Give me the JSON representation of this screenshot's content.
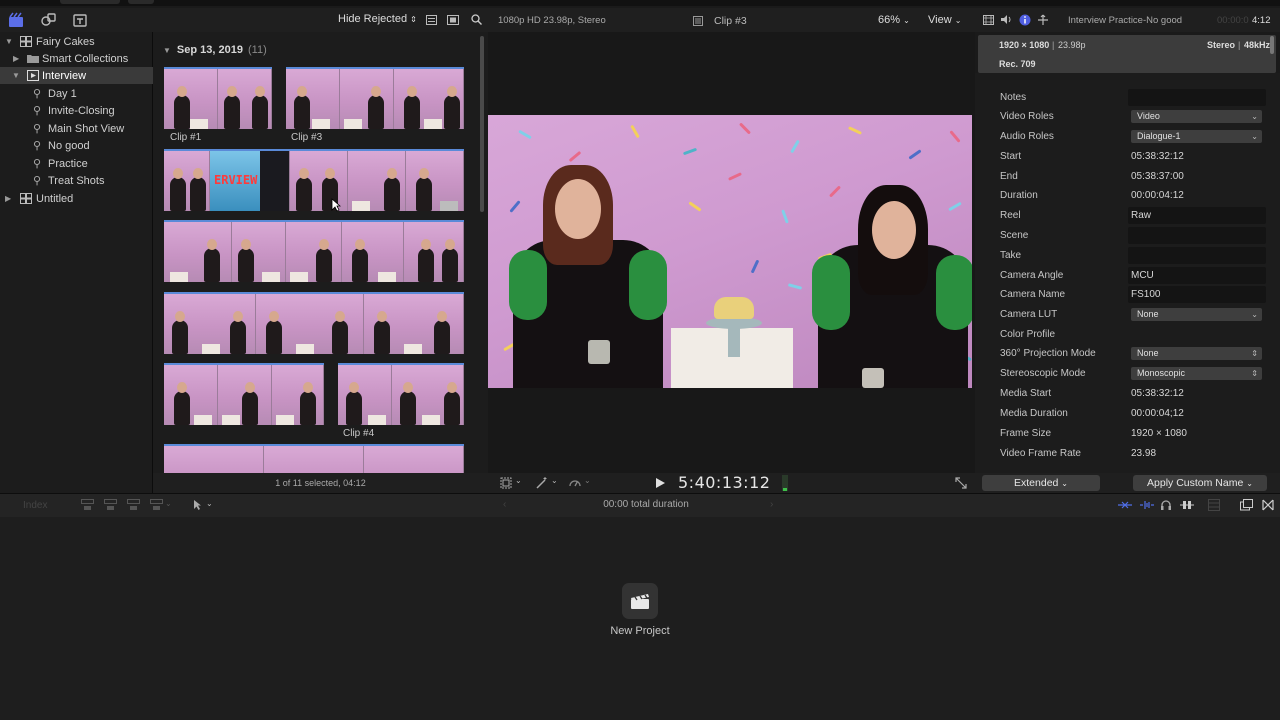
{
  "library": {
    "items": [
      {
        "label": "Fairy Cakes",
        "icon": "library-icon",
        "expanded": true
      },
      {
        "label": "Smart Collections",
        "icon": "folder-icon",
        "expanded": false
      },
      {
        "label": "Interview",
        "icon": "event-icon",
        "expanded": true,
        "selected": true
      },
      {
        "label": "Day 1",
        "icon": "keyword-icon"
      },
      {
        "label": "Invite-Closing",
        "icon": "keyword-icon"
      },
      {
        "label": "Main Shot View",
        "icon": "keyword-icon"
      },
      {
        "label": "No good",
        "icon": "keyword-icon"
      },
      {
        "label": "Practice",
        "icon": "keyword-icon"
      },
      {
        "label": "Treat Shots",
        "icon": "keyword-icon"
      },
      {
        "label": "Untitled",
        "icon": "library-icon",
        "expanded": false
      }
    ]
  },
  "browser": {
    "filter": "Hide Rejected",
    "date_header": "Sep 13, 2019",
    "count": "(11)",
    "clips": [
      "Clip #1",
      "Clip #3",
      "Clip #4"
    ],
    "selection": "1 of 11 selected, 04:12"
  },
  "viewer": {
    "format": "1080p HD 23.98p, Stereo",
    "clip_name": "Clip #3",
    "zoom": "66%",
    "view": "View",
    "timecode": "5:40:13:12"
  },
  "inspector": {
    "title": "Interview Practice-No good",
    "duration_short": "4:12",
    "resolution": "1920 × 1080",
    "framerate": "23.98p",
    "audio": "Stereo",
    "sample_rate": "48kHz",
    "color_space": "Rec. 709",
    "rows": [
      {
        "key": "Notes",
        "kind": "box",
        "value": ""
      },
      {
        "key": "Video Roles",
        "kind": "select",
        "value": "Video"
      },
      {
        "key": "Audio Roles",
        "kind": "select",
        "value": "Dialogue-1"
      },
      {
        "key": "Start",
        "kind": "text",
        "value": "05:38:32:12"
      },
      {
        "key": "End",
        "kind": "text",
        "value": "05:38:37:00"
      },
      {
        "key": "Duration",
        "kind": "text",
        "value": "00:00:04:12"
      },
      {
        "key": "Reel",
        "kind": "box",
        "value": "Raw"
      },
      {
        "key": "Scene",
        "kind": "box",
        "value": ""
      },
      {
        "key": "Take",
        "kind": "box",
        "value": ""
      },
      {
        "key": "Camera Angle",
        "kind": "box",
        "value": "MCU"
      },
      {
        "key": "Camera Name",
        "kind": "box",
        "value": "FS100"
      },
      {
        "key": "Camera LUT",
        "kind": "select",
        "value": "None"
      },
      {
        "key": "Color Profile",
        "kind": "text",
        "value": ""
      },
      {
        "key": "360° Projection Mode",
        "kind": "select",
        "value": "None"
      },
      {
        "key": "Stereoscopic Mode",
        "kind": "select",
        "value": "Monoscopic"
      },
      {
        "key": "Media Start",
        "kind": "text",
        "value": "05:38:32:12"
      },
      {
        "key": "Media Duration",
        "kind": "text",
        "value": "00:00:04;12"
      },
      {
        "key": "Frame Size",
        "kind": "text",
        "value": "1920 × 1080"
      },
      {
        "key": "Video Frame Rate",
        "kind": "text",
        "value": "23.98"
      }
    ],
    "metadata_view": "Extended",
    "apply_name": "Apply Custom Name"
  },
  "timeline": {
    "index_label": "Index",
    "total_duration": "00:00 total duration",
    "new_project": "New Project"
  }
}
